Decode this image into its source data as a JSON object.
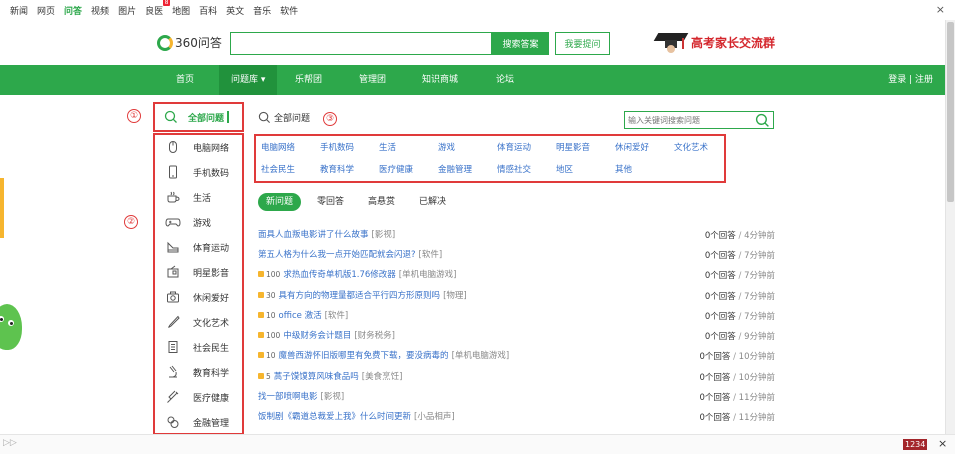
{
  "top_nav": {
    "items": [
      "新闻",
      "网页",
      "问答",
      "视频",
      "图片",
      "良医",
      "地图",
      "百科",
      "英文",
      "音乐",
      "软件"
    ],
    "active_index": 2,
    "badge_index": 5,
    "badge": "8"
  },
  "close_label": "×",
  "header": {
    "logo_text": "360问答",
    "search_button": "搜索答案",
    "ask_button": "我要提问",
    "promo_text": "高考家长交流群"
  },
  "main_nav": {
    "items": [
      "首页",
      "问题库 ▾",
      "乐帮团",
      "管理团",
      "知识商城",
      "论坛"
    ],
    "active_index": 1,
    "login": "登录 | 注册"
  },
  "annotations": [
    "①",
    "②",
    "③"
  ],
  "sidebar": {
    "all_label": "全部问题",
    "items": [
      {
        "label": "电脑网络",
        "icon": "mouse-icon"
      },
      {
        "label": "手机数码",
        "icon": "phone-icon"
      },
      {
        "label": "生活",
        "icon": "cup-icon"
      },
      {
        "label": "游戏",
        "icon": "gamepad-icon"
      },
      {
        "label": "体育运动",
        "icon": "sport-icon"
      },
      {
        "label": "明星影音",
        "icon": "film-icon"
      },
      {
        "label": "休闲爱好",
        "icon": "camera-icon"
      },
      {
        "label": "文化艺术",
        "icon": "brush-icon"
      },
      {
        "label": "社会民生",
        "icon": "document-icon"
      },
      {
        "label": "教育科学",
        "icon": "microscope-icon"
      },
      {
        "label": "医疗健康",
        "icon": "syringe-icon"
      },
      {
        "label": "金融管理",
        "icon": "coins-icon"
      }
    ]
  },
  "category_panel": {
    "header": "全部问题",
    "search_placeholder": "输入关键词搜索问题",
    "row1": [
      "电脑网络",
      "手机数码",
      "生活",
      "游戏",
      "体育运动",
      "明星影音",
      "休闲爱好",
      "文化艺术"
    ],
    "row2": [
      "社会民生",
      "教育科学",
      "医疗健康",
      "金融管理",
      "情感社交",
      "地区",
      "其他"
    ]
  },
  "tabs": [
    "新问题",
    "零回答",
    "高悬赏",
    "已解决"
  ],
  "questions": [
    {
      "reward": "",
      "title": "面具人血叛电影讲了什么故事",
      "category": "[影视]",
      "answers": "0个回答",
      "time": "4分钟前"
    },
    {
      "reward": "",
      "title": "第五人格为什么我一点开始匹配就会闪退?",
      "category": "[软件]",
      "answers": "0个回答",
      "time": "7分钟前"
    },
    {
      "reward": "100",
      "title": "求热血传奇单机版1.76修改器",
      "category": "[单机电脑游戏]",
      "answers": "0个回答",
      "time": "7分钟前"
    },
    {
      "reward": "30",
      "title": "具有方向的物理量都适合平行四方形原则吗",
      "category": "[物理]",
      "answers": "0个回答",
      "time": "7分钟前"
    },
    {
      "reward": "10",
      "title": "office 激活",
      "category": "[软件]",
      "answers": "0个回答",
      "time": "7分钟前"
    },
    {
      "reward": "100",
      "title": "中级财务会计题目",
      "category": "[财务税务]",
      "answers": "0个回答",
      "time": "9分钟前"
    },
    {
      "reward": "10",
      "title": "魔兽西游怀旧版哪里有免费下载，要没病毒的",
      "category": "[单机电脑游戏]",
      "answers": "0个回答",
      "time": "10分钟前"
    },
    {
      "reward": "5",
      "title": "蒿子馍馍算风味食品吗",
      "category": "[美食烹饪]",
      "answers": "0个回答",
      "time": "10分钟前"
    },
    {
      "reward": "",
      "title": "找一部喷啊电影",
      "category": "[影视]",
      "answers": "0个回答",
      "time": "11分钟前"
    },
    {
      "reward": "",
      "title": "饭制剧《霸道总裁爱上我》什么时间更新",
      "category": "[小品相声]",
      "answers": "0个回答",
      "time": "11分钟前"
    }
  ],
  "bottom_bar": {
    "arrows": "▷▷",
    "counter": "1234",
    "close": "×"
  },
  "colors": {
    "brand_green": "#2da84b",
    "annotation_red": "#e03a3a",
    "link_blue": "#3972c9",
    "promo_red": "#d4262c"
  }
}
